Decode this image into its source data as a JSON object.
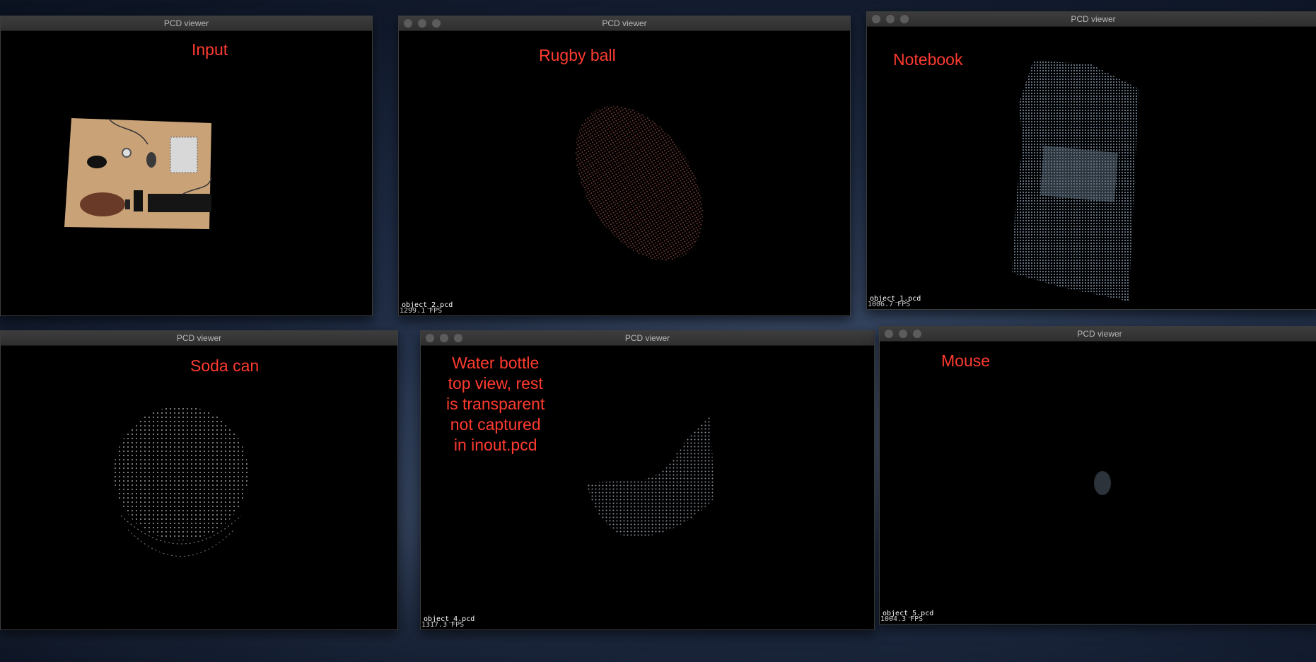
{
  "windows": [
    {
      "id": "input",
      "title": "PCD viewer",
      "annotation": "Input",
      "filename": "",
      "fps": ""
    },
    {
      "id": "rugby",
      "title": "PCD viewer",
      "annotation": "Rugby ball",
      "filename": "object_2.pcd",
      "fps": "1299.1 FPS"
    },
    {
      "id": "notebook",
      "title": "PCD viewer",
      "annotation": "Notebook",
      "filename": "object_1.pcd",
      "fps": "1006.7 FPS"
    },
    {
      "id": "soda",
      "title": "PCD viewer",
      "annotation": "Soda can",
      "filename": "",
      "fps": ""
    },
    {
      "id": "bottle",
      "title": "PCD viewer",
      "annotation_lines": [
        "Water bottle",
        "top view, rest",
        "is transparent",
        "not captured",
        "in inout.pcd"
      ],
      "filename": "object_4.pcd",
      "fps": "1317.3 FPS"
    },
    {
      "id": "mouse",
      "title": "PCD viewer",
      "annotation": "Mouse",
      "filename": "object_5.pcd",
      "fps": "1004.3 FPS"
    }
  ],
  "colors": {
    "annotation": "#ff3b30",
    "titlebar": "#333333",
    "canvas": "#000000",
    "rugby_points": "#7a4038",
    "notebook_points": "#8ea6bd",
    "soda_points": "#b9b9b9",
    "bottle_points": "#9aa4ad"
  },
  "icons": [
    "traffic-light-close-icon",
    "traffic-light-minimize-icon",
    "traffic-light-zoom-icon"
  ]
}
